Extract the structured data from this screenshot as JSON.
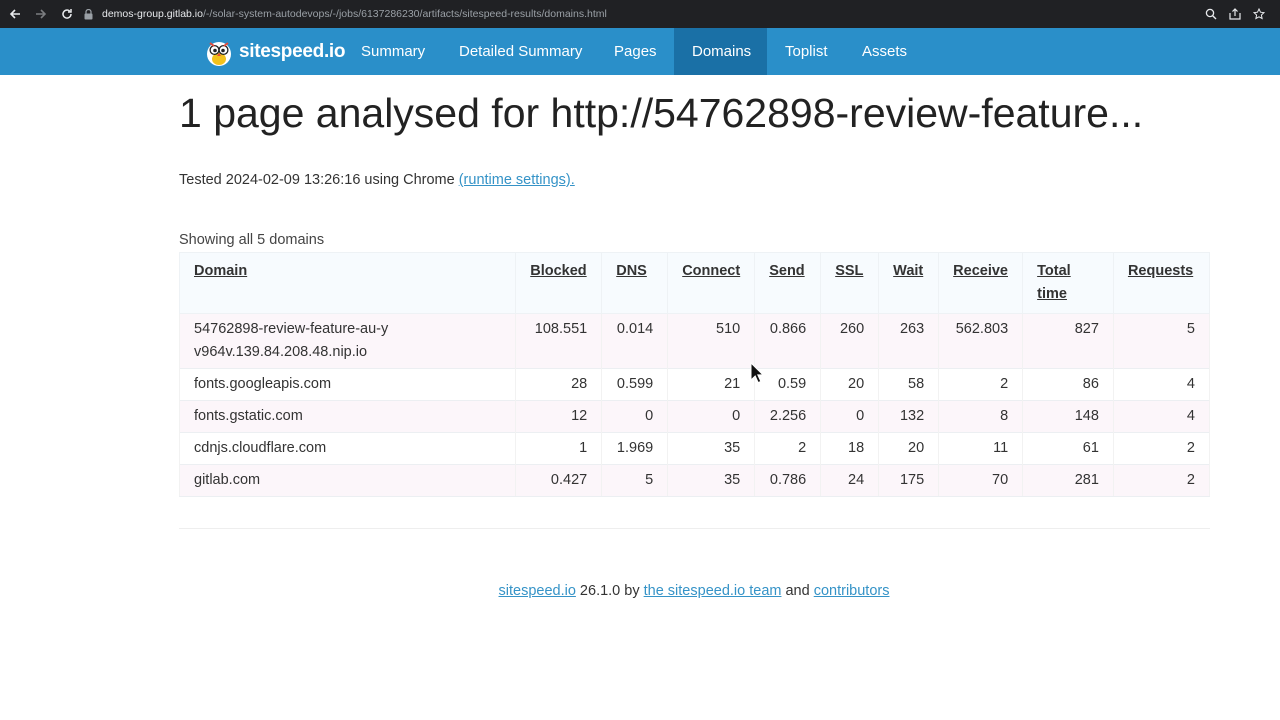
{
  "browser": {
    "url_host": "demos-group.gitlab.io",
    "url_path": "/-/solar-system-autodevops/-/jobs/6137286230/artifacts/sitespeed-results/domains.html"
  },
  "navbar": {
    "brand": "sitespeed.io",
    "items": [
      {
        "label": "Summary"
      },
      {
        "label": "Detailed Summary"
      },
      {
        "label": "Pages"
      },
      {
        "label": "Domains"
      },
      {
        "label": "Toplist"
      },
      {
        "label": "Assets"
      }
    ],
    "active": "Domains",
    "color": "#2a8fc9",
    "active_color": "#1a70a6"
  },
  "main": {
    "title": "1 page analysed for http://54762898-review-feature...",
    "tested_prefix": "Tested 2024-02-09 13:26:16 using Chrome",
    "runtime_link": "(runtime settings).",
    "showing": "Showing all 5 domains"
  },
  "table": {
    "headers": [
      "Domain",
      "Blocked",
      "DNS",
      "Connect",
      "Send",
      "SSL",
      "Wait",
      "Receive",
      "Total time",
      "Requests"
    ],
    "rows": [
      {
        "domain": "54762898-review-feature-au-yv964v.139.84.208.48.nip.io",
        "blocked": "108.551",
        "dns": "0.014",
        "connect": "510",
        "send": "0.866",
        "ssl": "260",
        "wait": "263",
        "receive": "562.803",
        "total": "827",
        "requests": "5"
      },
      {
        "domain": "fonts.googleapis.com",
        "blocked": "28",
        "dns": "0.599",
        "connect": "21",
        "send": "0.59",
        "ssl": "20",
        "wait": "58",
        "receive": "2",
        "total": "86",
        "requests": "4"
      },
      {
        "domain": "fonts.gstatic.com",
        "blocked": "12",
        "dns": "0",
        "connect": "0",
        "send": "2.256",
        "ssl": "0",
        "wait": "132",
        "receive": "8",
        "total": "148",
        "requests": "4"
      },
      {
        "domain": "cdnjs.cloudflare.com",
        "blocked": "1",
        "dns": "1.969",
        "connect": "35",
        "send": "2",
        "ssl": "18",
        "wait": "20",
        "receive": "11",
        "total": "61",
        "requests": "2"
      },
      {
        "domain": "gitlab.com",
        "blocked": "0.427",
        "dns": "5",
        "connect": "35",
        "send": "0.786",
        "ssl": "24",
        "wait": "175",
        "receive": "70",
        "total": "281",
        "requests": "2"
      }
    ]
  },
  "footer": {
    "link1": "sitespeed.io",
    "version": " 26.1.0 by ",
    "link2": "the sitespeed.io team",
    "and": " and ",
    "link3": "contributors"
  }
}
